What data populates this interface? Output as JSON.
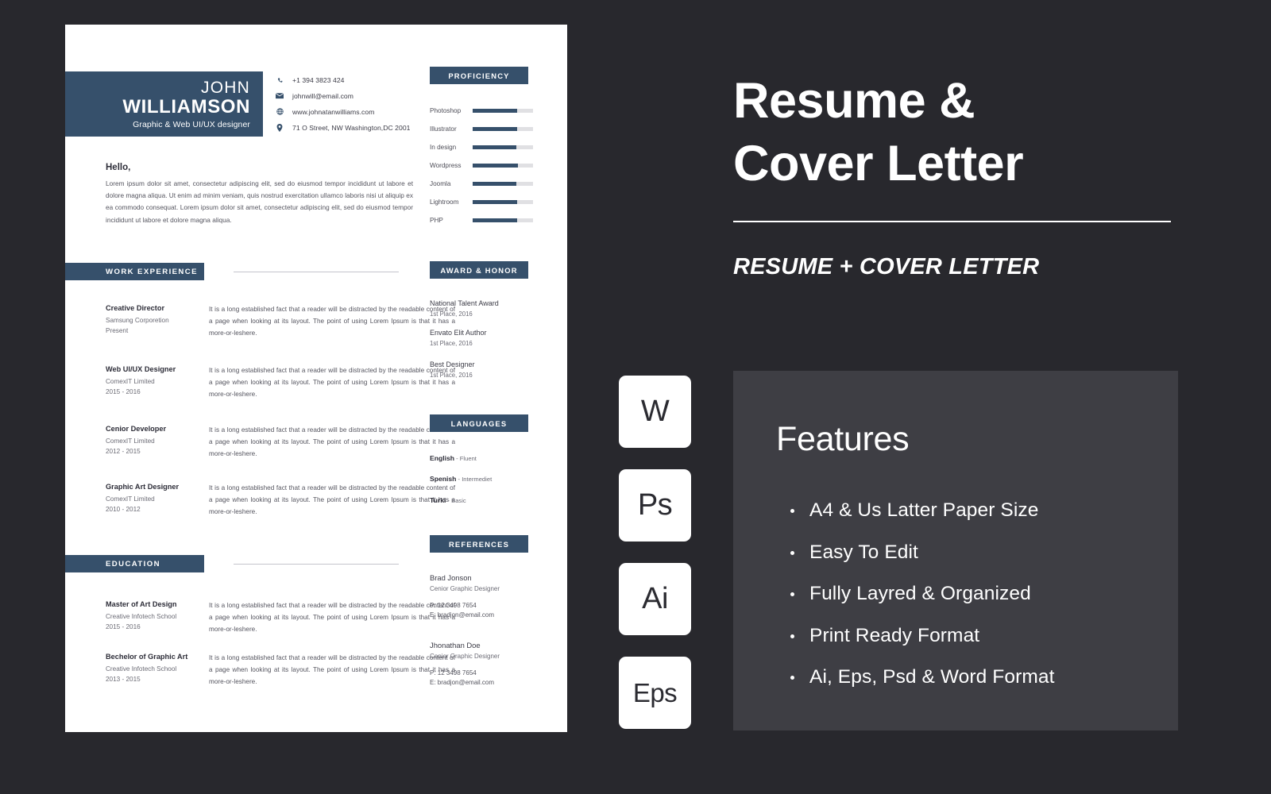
{
  "colors": {
    "page_background": "#28282d",
    "navy_accent": "#36506b",
    "paper": "#ffffff",
    "features_panel": "#3e3e44"
  },
  "resume": {
    "name_first": "JOHN",
    "name_last": "WILLIAMSON",
    "role": "Graphic & Web UI/UX designer",
    "contacts": [
      {
        "icon": "phone-icon",
        "text": "+1 394 3823 424"
      },
      {
        "icon": "envelope-icon",
        "text": "johnwill@email.com"
      },
      {
        "icon": "globe-icon",
        "text": "www.johnatanwilliams.com"
      },
      {
        "icon": "location-pin-icon",
        "text": "71 O Street, NW Washington,DC 2001"
      }
    ],
    "intro": {
      "title": "Hello,",
      "body": "Lorem ipsum dolor sit amet, consectetur adipiscing elit, sed do eiusmod tempor incididunt ut labore et dolore magna aliqua. Ut enim ad minim veniam, quis nostrud exercitation ullamco laboris nisi ut aliquip ex ea commodo consequat. Lorem ipsum dolor sit amet, consectetur adipiscing elit, sed do eiusmod tempor incididunt ut labore et dolore magna aliqua."
    },
    "sections": {
      "work_experience": "WORK EXPERIENCE",
      "education": "EDUCATION",
      "proficiency": "PROFICIENCY",
      "award_honor": "AWARD & HONOR",
      "languages": "LANGUAGES",
      "references": "REFERENCES"
    },
    "work_experience": [
      {
        "job": "Creative Director",
        "org": "Samsung Corporetion",
        "years": "Present",
        "desc": "It is a long established fact that a reader will be distracted by the readable content of a page when looking at its layout. The point of using Lorem Ipsum is that it has a more-or-leshere."
      },
      {
        "job": "Web UI/UX Designer",
        "org": "ComexIT Limited",
        "years": "2015 - 2016",
        "desc": "It is a long established fact that a reader will be distracted by the readable content of a page when looking at its layout. The point of using Lorem Ipsum is that it has a more-or-leshere."
      },
      {
        "job": "Cenior Developer",
        "org": "ComexIT Limited",
        "years": "2012 - 2015",
        "desc": "It is a long established fact that a reader will be distracted by the readable content of a page when looking at its layout. The point of using Lorem Ipsum is that it has a more-or-leshere."
      },
      {
        "job": "Graphic Art Designer",
        "org": "ComexIT Limited",
        "years": "2010 - 2012",
        "desc": "It is a long established fact that a reader will be distracted by the readable content of a page when looking at its layout. The point of using Lorem Ipsum is that it has a more-or-leshere."
      }
    ],
    "education": [
      {
        "job": "Master of Art Design",
        "org": "Creative Infotech School",
        "years": "2015 - 2016",
        "desc": "It is a long established fact that a reader will be distracted by the readable content of a page when looking at its layout. The point of using Lorem Ipsum is that it has a more-or-leshere."
      },
      {
        "job": "Bechelor of Graphic Art",
        "org": "Creative Infotech School",
        "years": "2013 - 2015",
        "desc": "It is a long established fact that a reader will be distracted by the readable content of a page when looking at its layout. The point of using Lorem Ipsum is that it has a more-or-leshere."
      }
    ],
    "proficiency": [
      {
        "name": "Photoshop",
        "percent": 74
      },
      {
        "name": "Illustrator",
        "percent": 74
      },
      {
        "name": "In design",
        "percent": 73
      },
      {
        "name": "Wordpress",
        "percent": 75
      },
      {
        "name": "Joomla",
        "percent": 73
      },
      {
        "name": "Lightroom",
        "percent": 74
      },
      {
        "name": "PHP",
        "percent": 74
      }
    ],
    "awards": [
      {
        "name": "National Talent Award",
        "place": "1st Place, 2016"
      },
      {
        "name": "Envato Elit Author",
        "place": "1st Place, 2016"
      },
      {
        "name": "Best Designer",
        "place": "1st Place, 2016"
      }
    ],
    "languages": [
      {
        "name": "English",
        "level": "Fluent"
      },
      {
        "name": "Spenish",
        "level": "Intermediet"
      },
      {
        "name": "Turki",
        "level": "Basic"
      }
    ],
    "references": [
      {
        "name": "Brad Jonson",
        "role": "Cenior Graphic Designer",
        "phone": "P: 12 3498 7654",
        "email": "E: bradjon@email.com"
      },
      {
        "name": "Jhonathan Doe",
        "role": "Cenior Graphic Designer",
        "phone": "P: 12 3498 7654",
        "email": "E: bradjon@email.com"
      }
    ]
  },
  "promo": {
    "title_line1": "Resume &",
    "title_line2": "Cover  Letter",
    "subtitle": "RESUME + COVER LETTER",
    "badges": [
      {
        "label": "W"
      },
      {
        "label": "Ps"
      },
      {
        "label": "Ai"
      },
      {
        "label": "Eps"
      }
    ],
    "features_title": "Features",
    "features": [
      "A4 & Us Latter Paper Size",
      "Easy To Edit",
      "Fully Layred & Organized",
      "Print Ready Format",
      "Ai, Eps, Psd & Word Format"
    ]
  }
}
